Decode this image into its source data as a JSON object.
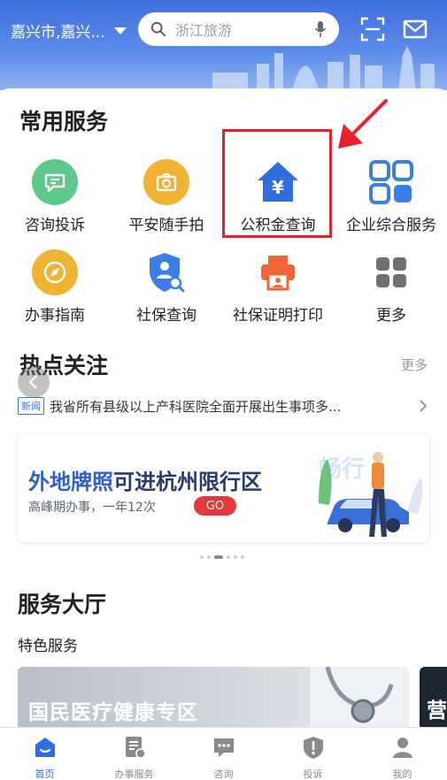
{
  "header": {
    "location": "嘉兴市,嘉兴...",
    "search_placeholder": "浙江旅游"
  },
  "common_services": {
    "title": "常用服务",
    "items": [
      {
        "label": "咨询投诉",
        "icon": "chat-bubble-icon",
        "color": "#5cc98a"
      },
      {
        "label": "平安随手拍",
        "icon": "camera-icon",
        "color": "#f2b233"
      },
      {
        "label": "公积金查询",
        "icon": "house-yuan-icon",
        "color": "#2f6de0"
      },
      {
        "label": "企业综合服务",
        "icon": "grid-icon",
        "color": "#3a7fe8"
      },
      {
        "label": "办事指南",
        "icon": "compass-icon",
        "color": "#f2b233"
      },
      {
        "label": "社保查询",
        "icon": "shield-search-icon",
        "color": "#3a7fe8"
      },
      {
        "label": "社保证明打印",
        "icon": "printer-icon",
        "color": "#f0643a"
      },
      {
        "label": "更多",
        "icon": "more-grid-icon",
        "color": "#666666"
      }
    ]
  },
  "hot_topics": {
    "title": "热点关注",
    "more": "更多",
    "badge": "新闻",
    "headline": "我省所有县级以上产科医院全面开展出生事项多..."
  },
  "banner": {
    "title_part1": "外地牌照",
    "title_part2": "可进杭州限行区",
    "subtitle": "高峰期办事，一年12次",
    "button": "GO",
    "active_slide": 3,
    "slide_count": 6
  },
  "service_hall": {
    "title": "服务大厅",
    "subtitle": "特色服务",
    "card1": "国民医疗健康专区",
    "card2": "营"
  },
  "bottom_nav": [
    {
      "label": "首页",
      "icon": "home-icon",
      "active": true
    },
    {
      "label": "办事服务",
      "icon": "document-icon",
      "active": false
    },
    {
      "label": "咨询",
      "icon": "message-icon",
      "active": false
    },
    {
      "label": "投诉",
      "icon": "shield-alert-icon",
      "active": false
    },
    {
      "label": "我的",
      "icon": "user-icon",
      "active": false
    }
  ]
}
